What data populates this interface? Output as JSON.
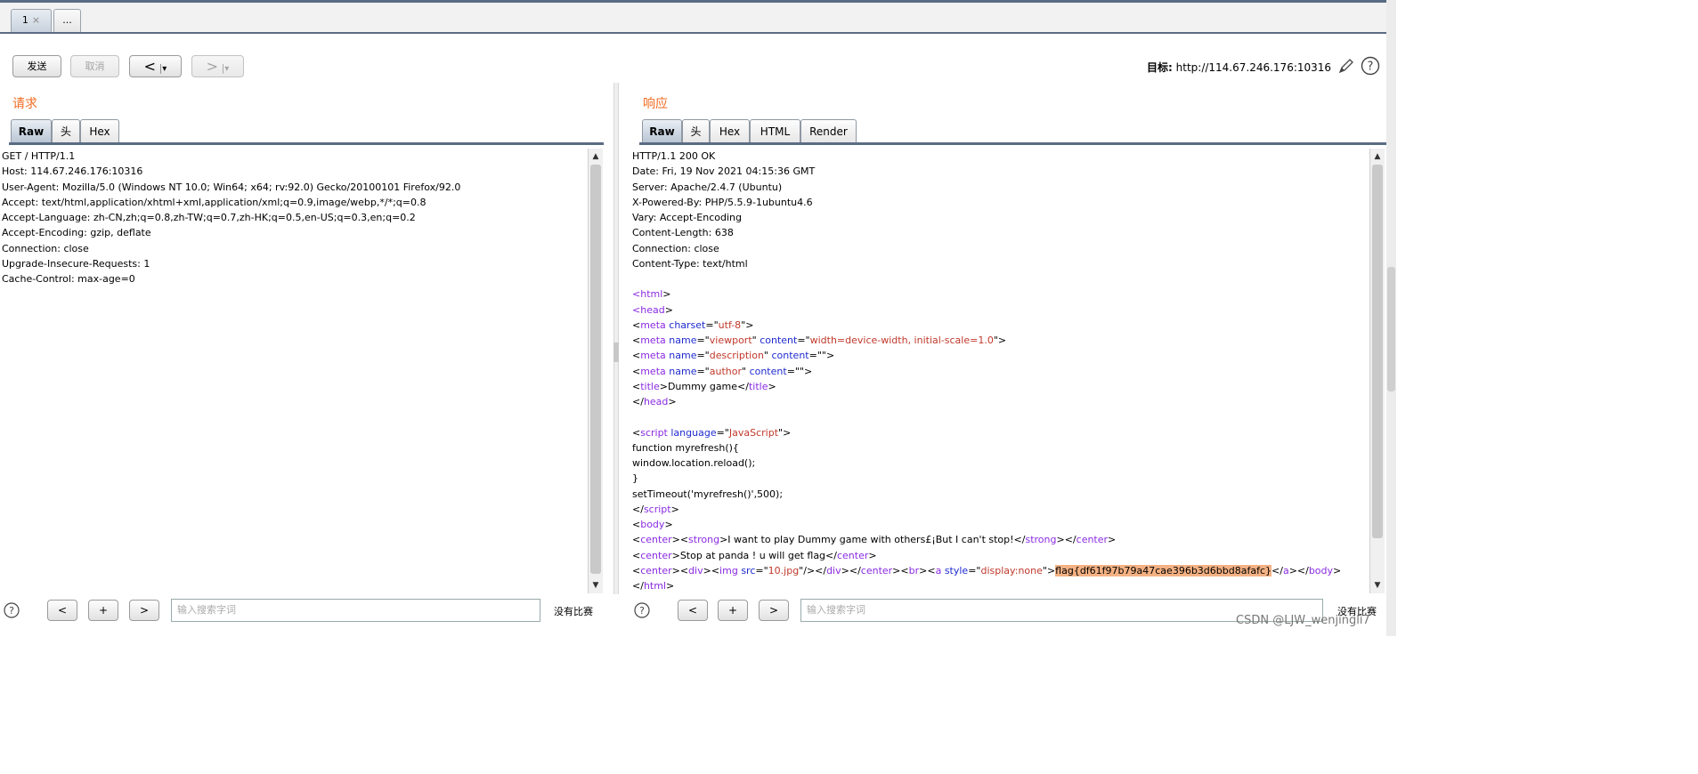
{
  "top_tabs": [
    {
      "label": "1",
      "close": "×"
    },
    {
      "label": "..."
    }
  ],
  "toolbar": {
    "send": "发送",
    "cancel": "取消",
    "back": "<",
    "forward": ">",
    "dropdown": "▾",
    "target_label": "目标:",
    "target_url": "http://114.67.246.176:10316"
  },
  "request": {
    "title": "请求",
    "tabs": [
      "Raw",
      "头",
      "Hex"
    ],
    "lines": [
      "GET / HTTP/1.1",
      "Host: 114.67.246.176:10316",
      "User-Agent: Mozilla/5.0 (Windows NT 10.0; Win64; x64; rv:92.0) Gecko/20100101 Firefox/92.0",
      "Accept: text/html,application/xhtml+xml,application/xml;q=0.9,image/webp,*/*;q=0.8",
      "Accept-Language: zh-CN,zh;q=0.8,zh-TW;q=0.7,zh-HK;q=0.5,en-US;q=0.3,en;q=0.2",
      "Accept-Encoding: gzip, deflate",
      "Connection: close",
      "Upgrade-Insecure-Requests: 1",
      "Cache-Control: max-age=0"
    ]
  },
  "response": {
    "title": "响应",
    "tabs": [
      "Raw",
      "头",
      "Hex",
      "HTML",
      "Render"
    ],
    "lines": [
      [
        {
          "t": "HTTP/1.1 200 OK"
        }
      ],
      [
        {
          "t": "Date: Fri, 19 Nov 2021 04:15:36 GMT"
        }
      ],
      [
        {
          "t": "Server: Apache/2.4.7 (Ubuntu)"
        }
      ],
      [
        {
          "t": "X-Powered-By: PHP/5.5.9-1ubuntu4.6"
        }
      ],
      [
        {
          "t": "Vary: Accept-Encoding"
        }
      ],
      [
        {
          "t": "Content-Length: 638"
        }
      ],
      [
        {
          "t": "Connection: close"
        }
      ],
      [
        {
          "t": "Content-Type: text/html"
        }
      ],
      [
        {
          "t": ""
        }
      ],
      [
        {
          "t": "<",
          "c": "tg"
        },
        {
          "t": "html",
          "c": "tg"
        },
        {
          "t": ">"
        }
      ],
      [
        {
          "t": "<",
          "c": "tg"
        },
        {
          "t": "head",
          "c": "tg"
        },
        {
          "t": ">"
        }
      ],
      [
        {
          "t": "<"
        },
        {
          "t": "meta",
          "c": "tg"
        },
        {
          "t": " "
        },
        {
          "t": "charset",
          "c": "at"
        },
        {
          "t": "=\""
        },
        {
          "t": "utf-8",
          "c": "vl"
        },
        {
          "t": "\">"
        }
      ],
      [
        {
          "t": "<"
        },
        {
          "t": "meta",
          "c": "tg"
        },
        {
          "t": " "
        },
        {
          "t": "name",
          "c": "at"
        },
        {
          "t": "=\""
        },
        {
          "t": "viewport",
          "c": "vl"
        },
        {
          "t": "\" "
        },
        {
          "t": "content",
          "c": "at"
        },
        {
          "t": "=\""
        },
        {
          "t": "width=device-width, initial-scale=1.0",
          "c": "vl"
        },
        {
          "t": "\">"
        }
      ],
      [
        {
          "t": "<"
        },
        {
          "t": "meta",
          "c": "tg"
        },
        {
          "t": " "
        },
        {
          "t": "name",
          "c": "at"
        },
        {
          "t": "=\""
        },
        {
          "t": "description",
          "c": "vl"
        },
        {
          "t": "\" "
        },
        {
          "t": "content",
          "c": "at"
        },
        {
          "t": "=\"\">"
        }
      ],
      [
        {
          "t": "<"
        },
        {
          "t": "meta",
          "c": "tg"
        },
        {
          "t": " "
        },
        {
          "t": "name",
          "c": "at"
        },
        {
          "t": "=\""
        },
        {
          "t": "author",
          "c": "vl"
        },
        {
          "t": "\" "
        },
        {
          "t": "content",
          "c": "at"
        },
        {
          "t": "=\"\">"
        }
      ],
      [
        {
          "t": "<"
        },
        {
          "t": "title",
          "c": "tg"
        },
        {
          "t": ">Dummy game</"
        },
        {
          "t": "title",
          "c": "tg"
        },
        {
          "t": ">"
        }
      ],
      [
        {
          "t": "</"
        },
        {
          "t": "head",
          "c": "tg"
        },
        {
          "t": ">"
        }
      ],
      [
        {
          "t": ""
        }
      ],
      [
        {
          "t": "<"
        },
        {
          "t": "script",
          "c": "tg"
        },
        {
          "t": " "
        },
        {
          "t": "language",
          "c": "at"
        },
        {
          "t": "=\""
        },
        {
          "t": "JavaScript",
          "c": "vl"
        },
        {
          "t": "\">"
        }
      ],
      [
        {
          "t": "function myrefresh(){"
        }
      ],
      [
        {
          "t": "window.location.reload();"
        }
      ],
      [
        {
          "t": "}"
        }
      ],
      [
        {
          "t": "setTimeout('myrefresh()',500);"
        }
      ],
      [
        {
          "t": "</"
        },
        {
          "t": "script",
          "c": "tg"
        },
        {
          "t": ">"
        }
      ],
      [
        {
          "t": "<"
        },
        {
          "t": "body",
          "c": "tg"
        },
        {
          "t": ">"
        }
      ],
      [
        {
          "t": "<"
        },
        {
          "t": "center",
          "c": "tg"
        },
        {
          "t": "><"
        },
        {
          "t": "strong",
          "c": "tg"
        },
        {
          "t": ">I want to play Dummy game with others£¡But I can't stop!</"
        },
        {
          "t": "strong",
          "c": "tg"
        },
        {
          "t": "></"
        },
        {
          "t": "center",
          "c": "tg"
        },
        {
          "t": ">"
        }
      ],
      [
        {
          "t": "<"
        },
        {
          "t": "center",
          "c": "tg"
        },
        {
          "t": ">Stop at panda ! u will get flag</"
        },
        {
          "t": "center",
          "c": "tg"
        },
        {
          "t": ">"
        }
      ],
      [
        {
          "t": "<"
        },
        {
          "t": "center",
          "c": "tg"
        },
        {
          "t": "><"
        },
        {
          "t": "div",
          "c": "tg"
        },
        {
          "t": "><"
        },
        {
          "t": "img",
          "c": "tg"
        },
        {
          "t": " "
        },
        {
          "t": "src",
          "c": "at"
        },
        {
          "t": "=\""
        },
        {
          "t": "10.jpg",
          "c": "vl"
        },
        {
          "t": "\"/></"
        },
        {
          "t": "div",
          "c": "tg"
        },
        {
          "t": "></"
        },
        {
          "t": "center",
          "c": "tg"
        },
        {
          "t": "><"
        },
        {
          "t": "br",
          "c": "tg"
        },
        {
          "t": "><"
        },
        {
          "t": "a",
          "c": "tg"
        },
        {
          "t": " "
        },
        {
          "t": "style",
          "c": "at"
        },
        {
          "t": "=\""
        },
        {
          "t": "display:none",
          "c": "vl"
        },
        {
          "t": "\">"
        },
        {
          "t": "flag{df61f97b79a47cae396b3d6bbd8afafc}",
          "c": "hl"
        },
        {
          "t": "</"
        },
        {
          "t": "a",
          "c": "tg"
        },
        {
          "t": "></"
        },
        {
          "t": "body",
          "c": "tg"
        },
        {
          "t": ">"
        }
      ],
      [
        {
          "t": "</"
        },
        {
          "t": "html",
          "c": "tg"
        },
        {
          "t": ">"
        }
      ]
    ]
  },
  "search": {
    "placeholder": "输入搜索字词",
    "no_match": "没有比赛",
    "prev": "<",
    "add": "+",
    "next": ">"
  },
  "watermark": "CSDN @LJW_wenjingli7",
  "colors": {
    "accent": "#f26b21",
    "tag": "#8a2be2",
    "attr": "#1f2bd0",
    "value": "#c0392b",
    "highlight": "#f4b183",
    "tab_border": "#5a6b84"
  }
}
